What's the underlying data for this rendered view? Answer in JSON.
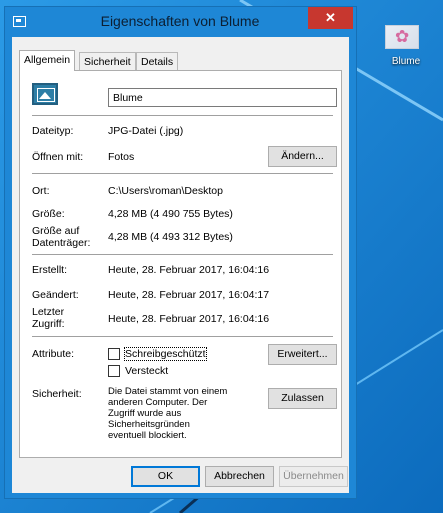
{
  "window": {
    "title": "Eigenschaften von Blume",
    "close_glyph": "✕"
  },
  "tabs": [
    {
      "label": "Allgemein",
      "active": true
    },
    {
      "label": "Sicherheit",
      "active": false
    },
    {
      "label": "Details",
      "active": false
    }
  ],
  "general": {
    "file_name": "Blume",
    "type_label": "Dateityp:",
    "type_value": "JPG-Datei (.jpg)",
    "open_with_label": "Öffnen mit:",
    "open_with_value": "Fotos",
    "change_button": "Ändern...",
    "location_label": "Ort:",
    "location_value": "C:\\Users\\roman\\Desktop",
    "size_label": "Größe:",
    "size_value": "4,28 MB (4 490 755 Bytes)",
    "size_on_disk_label": "Größe auf Datenträger:",
    "size_on_disk_value": "4,28 MB (4 493 312 Bytes)",
    "created_label": "Erstellt:",
    "created_value": "Heute, 28. Februar 2017, 16:04:16",
    "modified_label": "Geändert:",
    "modified_value": "Heute, 28. Februar 2017, 16:04:17",
    "accessed_label": "Letzter Zugriff:",
    "accessed_value": "Heute, 28. Februar 2017, 16:04:16",
    "attributes_label": "Attribute:",
    "readonly_label": "Schreibgeschützt",
    "readonly_checked": false,
    "hidden_label": "Versteckt",
    "hidden_checked": false,
    "advanced_button": "Erweitert...",
    "security_label": "Sicherheit:",
    "security_text": "Die Datei stammt von einem anderen Computer. Der Zugriff wurde aus Sicherheitsgründen eventuell blockiert.",
    "unblock_button": "Zulassen"
  },
  "footer": {
    "ok": "OK",
    "cancel": "Abbrechen",
    "apply": "Übernehmen"
  },
  "desktop": {
    "icon_label": "Blume"
  },
  "colors": {
    "desktop": "#1583d8",
    "titlebar": "#1e87d6",
    "close": "#c7372f"
  }
}
